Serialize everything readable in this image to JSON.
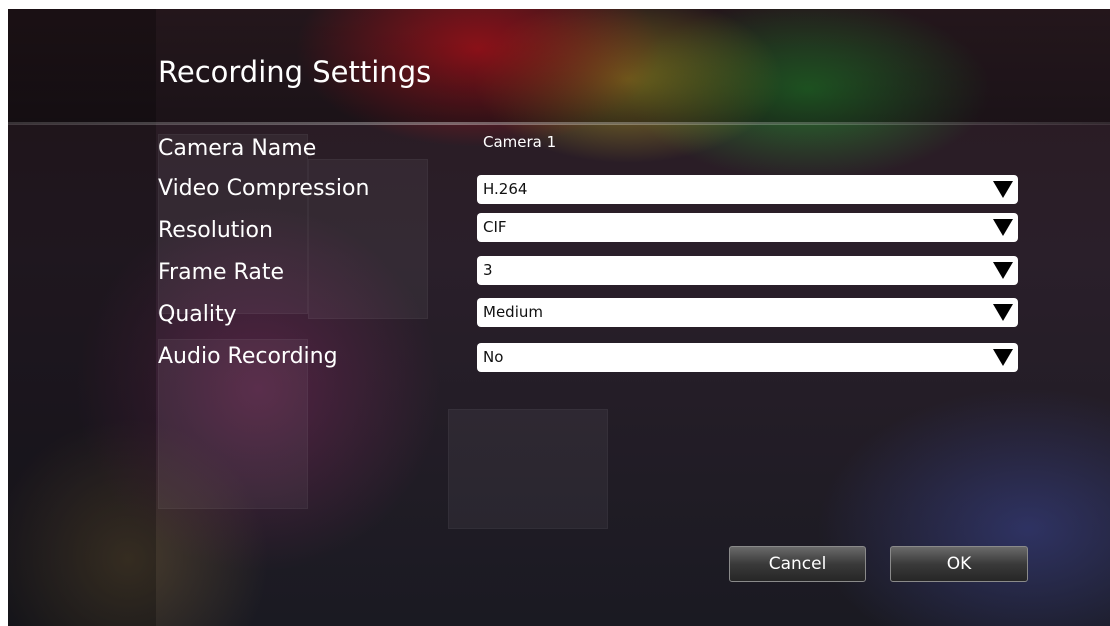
{
  "dialog": {
    "title": "Recording Settings"
  },
  "fields": [
    {
      "label": "Camera Name",
      "value": "Camera 1"
    },
    {
      "label": "Video Compression",
      "value": "H.264"
    },
    {
      "label": "Resolution",
      "value": "CIF"
    },
    {
      "label": "Frame Rate",
      "value": "3"
    },
    {
      "label": "Quality",
      "value": "Medium"
    },
    {
      "label": "Audio Recording",
      "value": "No"
    }
  ],
  "buttons": {
    "cancel_label": "Cancel",
    "ok_label": "OK"
  },
  "icons": {
    "dropdown": "triangle-down-icon"
  },
  "colors": {
    "field_background": "#ffffff",
    "label_text": "#ffffff",
    "button_gradient_top": "#6a6a6a",
    "button_gradient_bottom": "#262626"
  }
}
